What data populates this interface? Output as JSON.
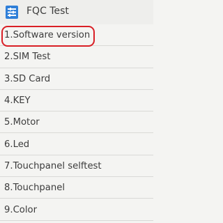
{
  "app": {
    "title": "FQC Test",
    "icon": "settings-tool-icon"
  },
  "items": [
    {
      "label": "1.Software version"
    },
    {
      "label": "2.SIM Test"
    },
    {
      "label": "3.SD Card"
    },
    {
      "label": "4.KEY"
    },
    {
      "label": "5.Motor"
    },
    {
      "label": "6.Led"
    },
    {
      "label": "7.Touchpanel selftest"
    },
    {
      "label": "8.Touchpanel"
    },
    {
      "label": "9.Color"
    }
  ],
  "colors": {
    "highlight": "#d91f26",
    "icon_blue": "#2f7fd8"
  }
}
